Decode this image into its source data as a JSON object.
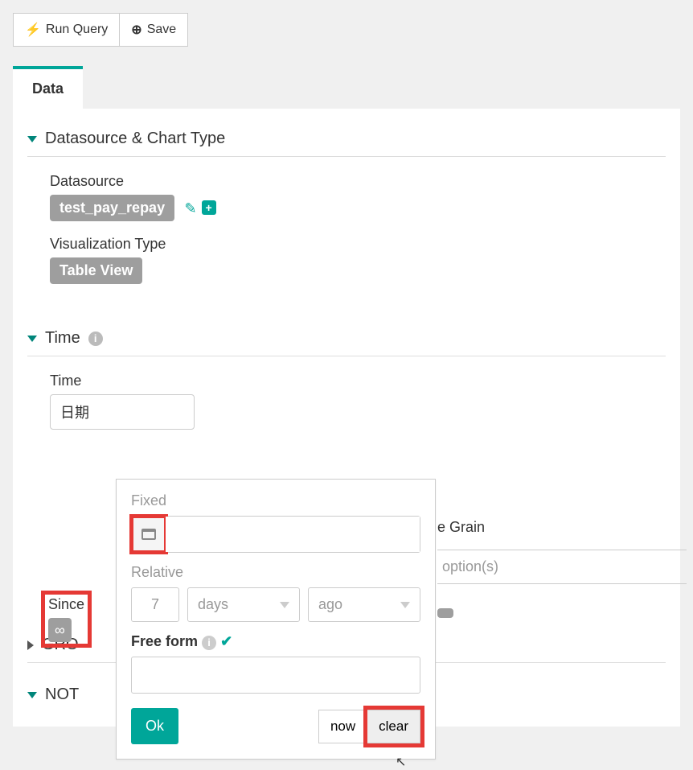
{
  "toolbar": {
    "run_query": "Run Query",
    "save": "Save"
  },
  "tabs": {
    "data": "Data"
  },
  "sections": {
    "datasource_chart": "Datasource & Chart Type",
    "time": "Time",
    "group": "GRO",
    "not": "NOT"
  },
  "datasource": {
    "label": "Datasource",
    "value": "test_pay_repay"
  },
  "viz": {
    "label": "Visualization Type",
    "value": "Table View"
  },
  "time": {
    "column_label": "Time",
    "column_value": "日期",
    "grain_label": "e Grain",
    "grain_placeholder": "option(s)",
    "since_label": "Since",
    "until_chip": ""
  },
  "popover": {
    "fixed_label": "Fixed",
    "relative_label": "Relative",
    "rel_num": "7",
    "rel_unit": "days",
    "rel_dir": "ago",
    "freeform_label": "Free form",
    "ok": "Ok",
    "now": "now",
    "clear": "clear"
  }
}
